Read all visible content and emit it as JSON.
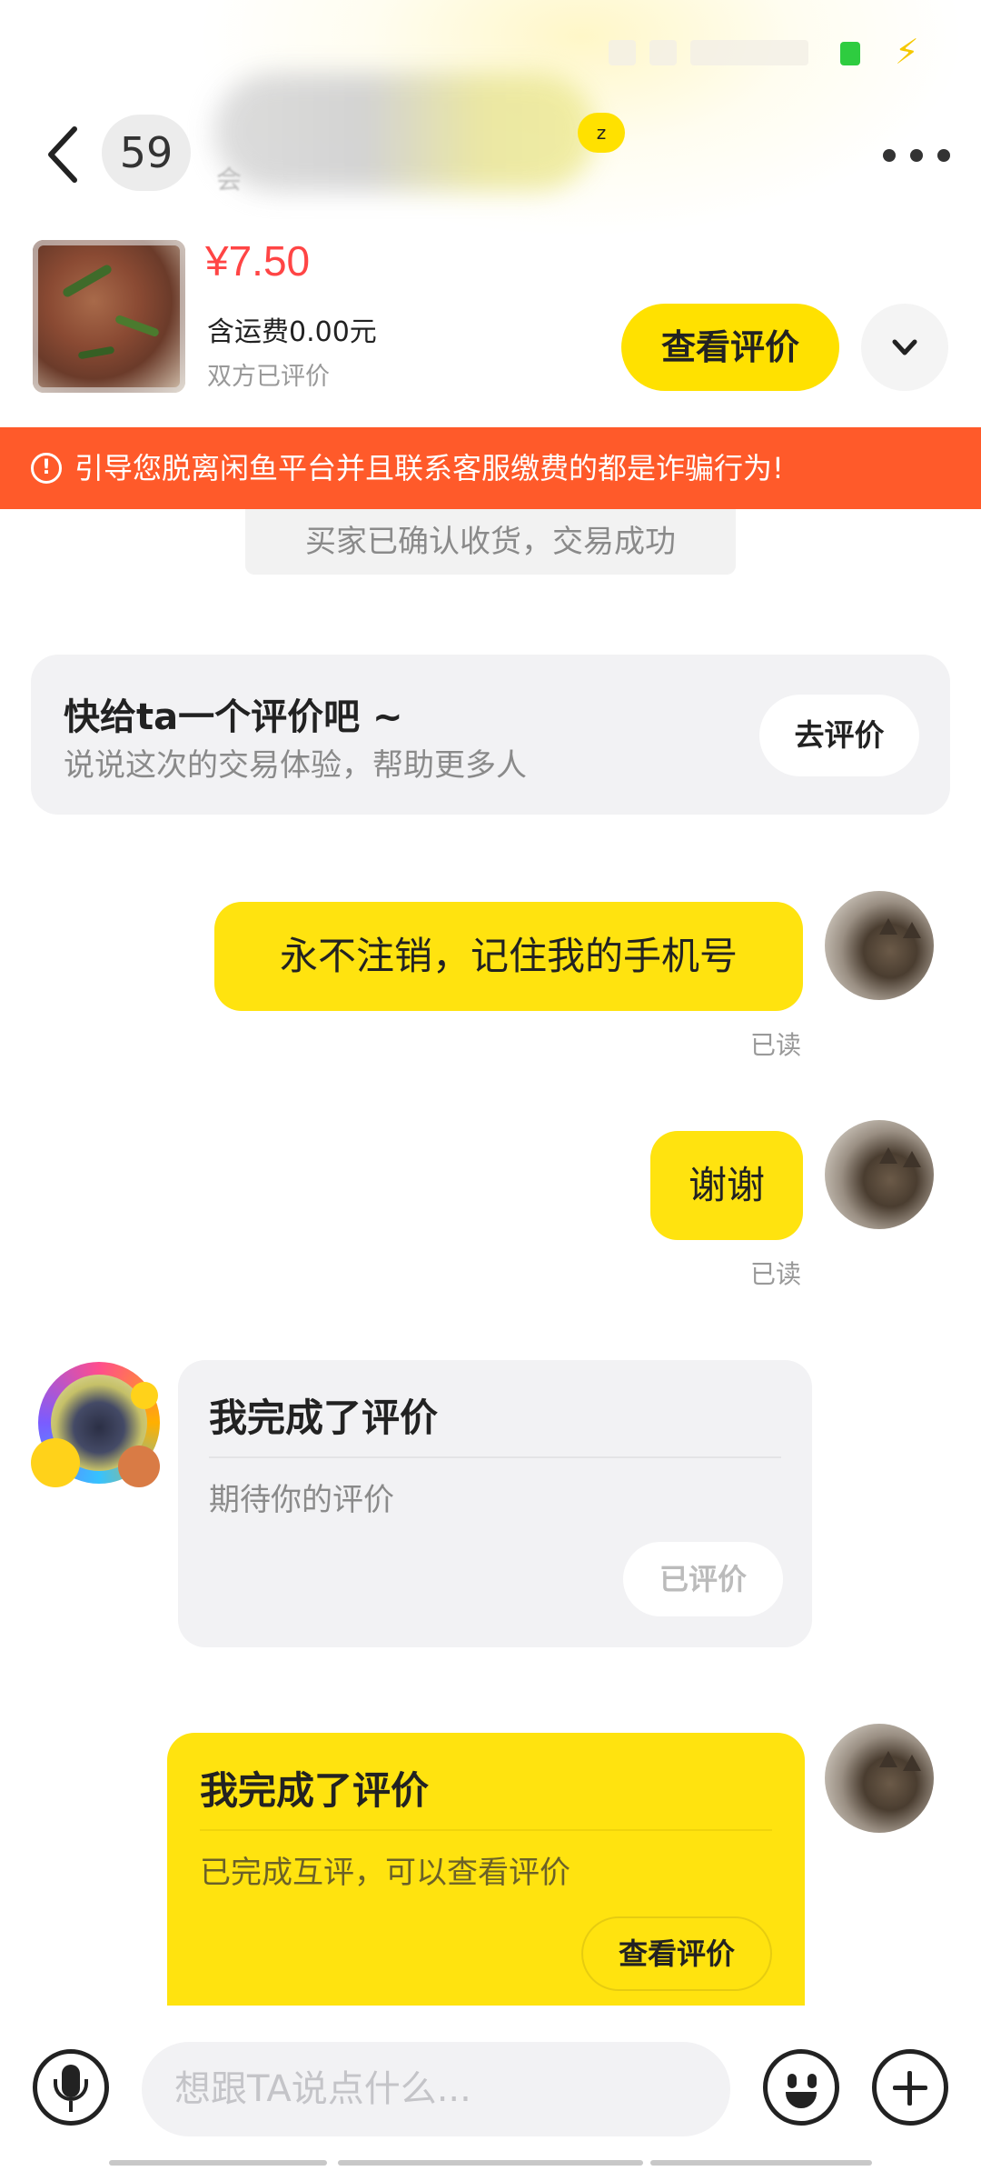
{
  "header": {
    "unread_count": "59",
    "name_tag": "z",
    "subtitle": "会"
  },
  "product": {
    "price": "¥7.50",
    "shipping": "含运费0.00元",
    "review_state": "双方已评价",
    "view_review_label": "查看评价"
  },
  "warning": {
    "icon": "!",
    "text": "引导您脱离闲鱼平台并且联系客服缴费的都是诈骗行为!"
  },
  "system_message": "买家已确认收货，交易成功",
  "review_prompt": {
    "title": "快给ta一个评价吧 ~",
    "subtitle": "说说这次的交易体验，帮助更多人",
    "button": "去评价"
  },
  "messages": [
    {
      "text": "永不注销，记住我的手机号",
      "status": "已读"
    },
    {
      "text": "谢谢",
      "status": "已读"
    }
  ],
  "card_other": {
    "title": "我完成了评价",
    "desc": "期待你的评价",
    "button": "已评价"
  },
  "card_mine": {
    "title": "我完成了评价",
    "desc": "已完成互评，可以查看评价",
    "button": "查看评价"
  },
  "input": {
    "placeholder": "想跟TA说点什么..."
  },
  "colors": {
    "accent_yellow": "#ffe100",
    "price_red": "#ff4545",
    "warning_orange": "#ff5a2a"
  },
  "icons": [
    "back-icon",
    "more-icon",
    "chevron-down-icon",
    "warning-icon",
    "microphone-icon",
    "emoji-icon",
    "plus-icon"
  ]
}
